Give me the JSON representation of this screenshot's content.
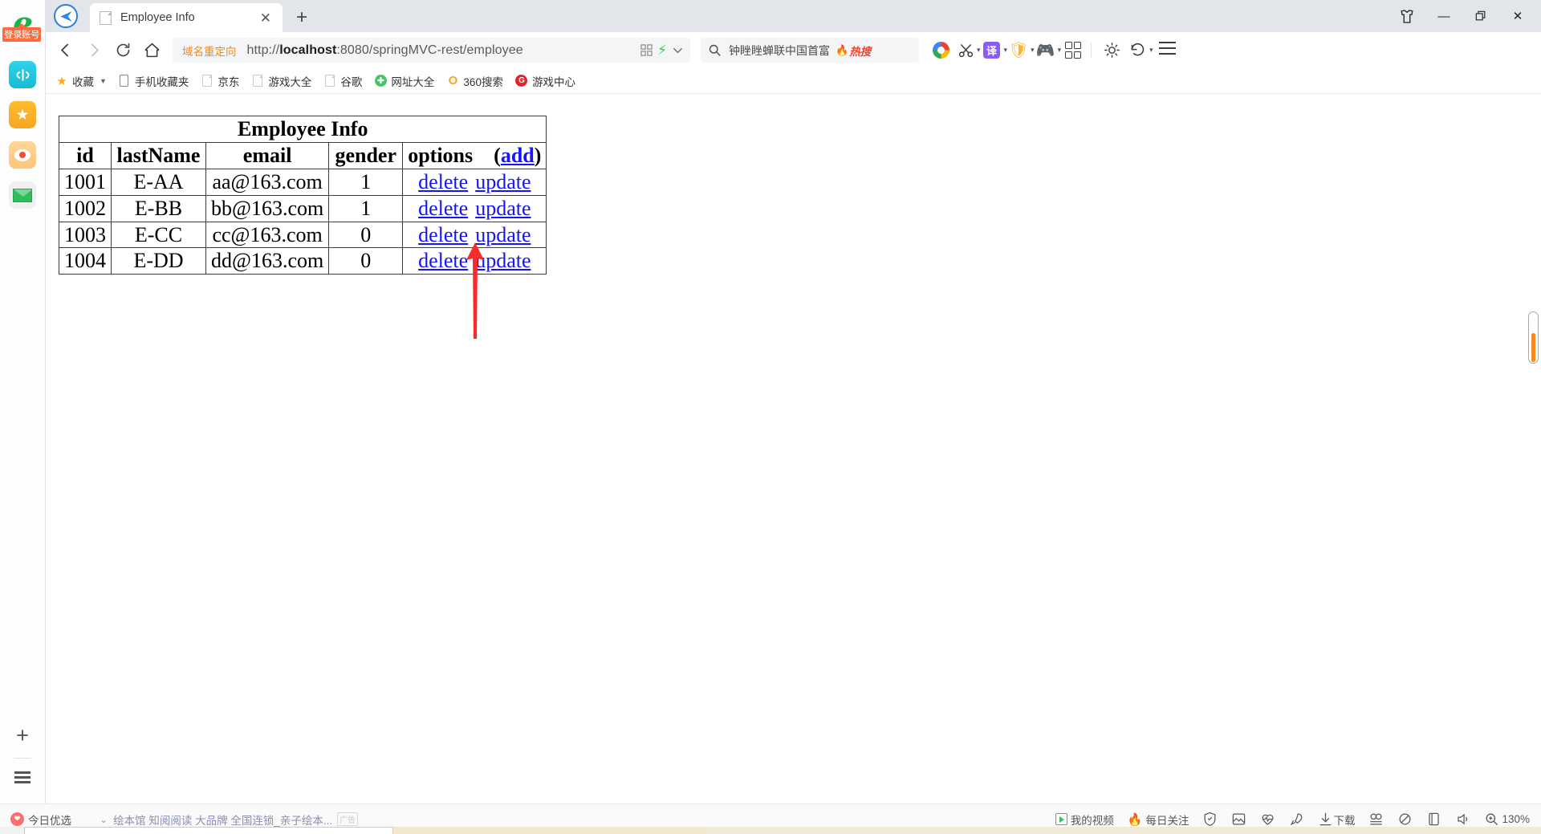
{
  "window": {
    "controls": [
      {
        "name": "skin-button",
        "label": "\u0000"
      },
      {
        "name": "minimize-button",
        "label": "—"
      },
      {
        "name": "maximize-button",
        "label": "❐"
      },
      {
        "name": "close-button",
        "label": "✕"
      }
    ]
  },
  "tabs": [
    {
      "title": "Employee Info",
      "close_label": "✕",
      "active": true
    }
  ],
  "new_tab_label": "+",
  "toolbar": {
    "back_label": "‹",
    "forward_label": "›",
    "reload_label": "↻",
    "home_label": "⌂",
    "translate_label": "译",
    "shield_label": "¥",
    "caret_label": "▾"
  },
  "address": {
    "redirect_tag": "域名重定向",
    "url_prefix": "http://",
    "url_host": "localhost",
    "url_rest": ":8080/springMVC-rest/employee",
    "full_url": "http://localhost:8080/springMVC-rest/employee"
  },
  "search": {
    "icon": "search-icon",
    "text": "钟睉睉蝉联中国首富",
    "badge": "热搜",
    "flame": "🔥"
  },
  "bookmarks": [
    {
      "label": "收藏",
      "icon": "star-icon"
    },
    {
      "label": "手机收藏夹",
      "icon": "phone-icon"
    },
    {
      "label": "京东",
      "icon": "doc-icon"
    },
    {
      "label": "游戏大全",
      "icon": "doc-icon"
    },
    {
      "label": "谷歌",
      "icon": "doc-icon"
    },
    {
      "label": "网址大全",
      "icon": "green-circle-icon"
    },
    {
      "label": "360搜索",
      "icon": "o-icon"
    },
    {
      "label": "游戏中心",
      "icon": "g-icon"
    }
  ],
  "sidebar": {
    "login_badge": "登录账号",
    "items": [
      {
        "name": "browser-logo",
        "label": "e"
      },
      {
        "name": "sidebar-item-cyan",
        "label": "⚗"
      },
      {
        "name": "sidebar-item-favorites",
        "label": "★"
      },
      {
        "name": "sidebar-item-weibo",
        "label": "◉"
      },
      {
        "name": "sidebar-item-mail",
        "label": "✉"
      }
    ],
    "add_label": "+",
    "list_label": "list-icon"
  },
  "page": {
    "table": {
      "caption": "Employee Info",
      "headers": [
        "id",
        "lastName",
        "email",
        "gender",
        "options"
      ],
      "options_header_prefix": "options　(",
      "options_add_link": "add",
      "options_header_suffix": ")",
      "rows": [
        {
          "id": "1001",
          "lastName": "E-AA",
          "email": "aa@163.com",
          "gender": "1",
          "delete": "delete",
          "update": "update"
        },
        {
          "id": "1002",
          "lastName": "E-BB",
          "email": "bb@163.com",
          "gender": "1",
          "delete": "delete",
          "update": "update"
        },
        {
          "id": "1003",
          "lastName": "E-CC",
          "email": "cc@163.com",
          "gender": "0",
          "delete": "delete",
          "update": "update"
        },
        {
          "id": "1004",
          "lastName": "E-DD",
          "email": "dd@163.com",
          "gender": "0",
          "delete": "delete",
          "update": "update"
        }
      ]
    },
    "annotation_arrow_color": "#f92a2a"
  },
  "statusbar": {
    "left_label": "今日优选",
    "chevron": "⌄",
    "ad_text": "绘本馆 知阅阅读 大品牌 全国连锁_亲子绘本...",
    "ad_tag": "广告",
    "right_items": [
      {
        "name": "my-video",
        "label": "我的视频"
      },
      {
        "name": "daily-follow",
        "label": "每日关注"
      },
      {
        "name": "shield-icon",
        "label": ""
      },
      {
        "name": "image-icon",
        "label": ""
      },
      {
        "name": "health-icon",
        "label": ""
      },
      {
        "name": "rocket-icon",
        "label": ""
      },
      {
        "name": "download",
        "label": "下载"
      },
      {
        "name": "ad-filter-icon",
        "label": ""
      },
      {
        "name": "privacy-icon",
        "label": ""
      },
      {
        "name": "window-icon",
        "label": ""
      },
      {
        "name": "sound-icon",
        "label": ""
      }
    ],
    "zoom_level": "130%"
  },
  "colors": {
    "accent_orange": "#f5881f",
    "link_blue": "#1414ff",
    "arrow_red": "#f92a2a",
    "tag_orange": "#f08a24"
  }
}
